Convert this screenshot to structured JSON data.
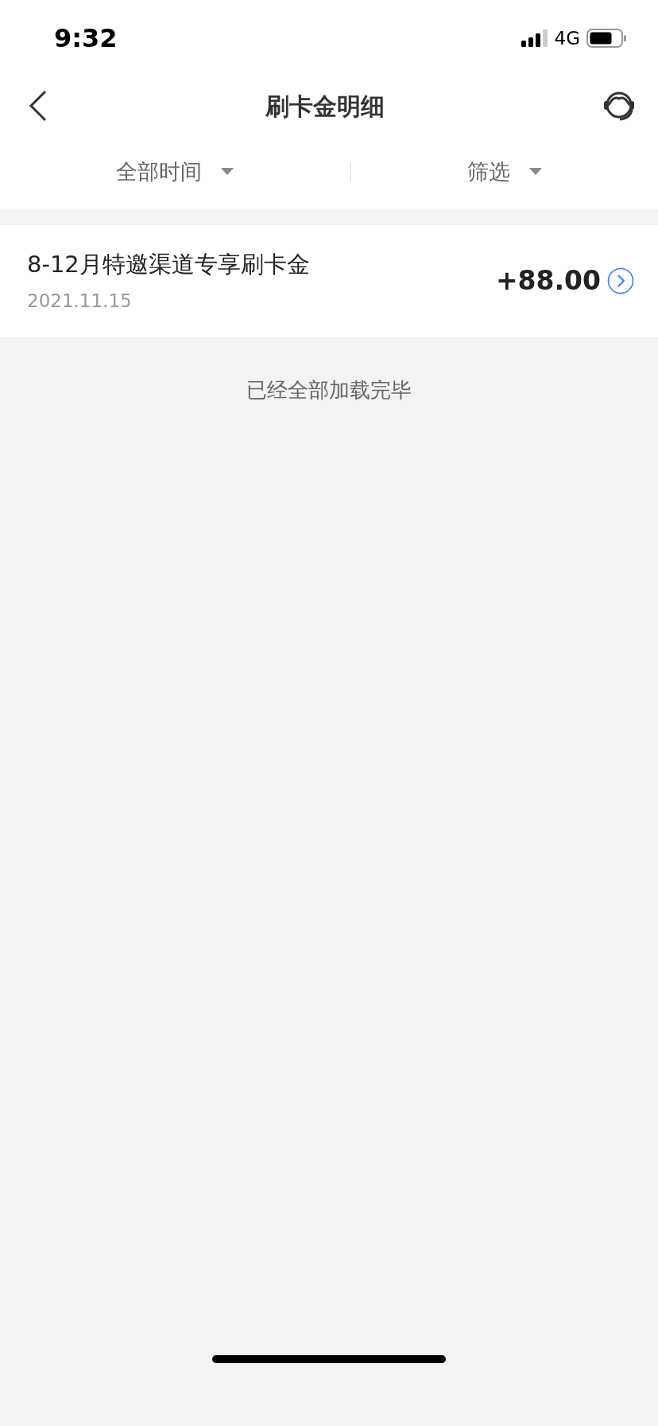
{
  "status_bar": {
    "time": "9:32",
    "network": "4G"
  },
  "nav": {
    "title": "刷卡金明细"
  },
  "filters": [
    {
      "label": "全部时间"
    },
    {
      "label": "筛选"
    }
  ],
  "records": [
    {
      "title": "8-12月特邀渠道专享刷卡金",
      "date": "2021.11.15",
      "amount": "+88.00"
    }
  ],
  "footer_note": "已经全部加载完毕"
}
